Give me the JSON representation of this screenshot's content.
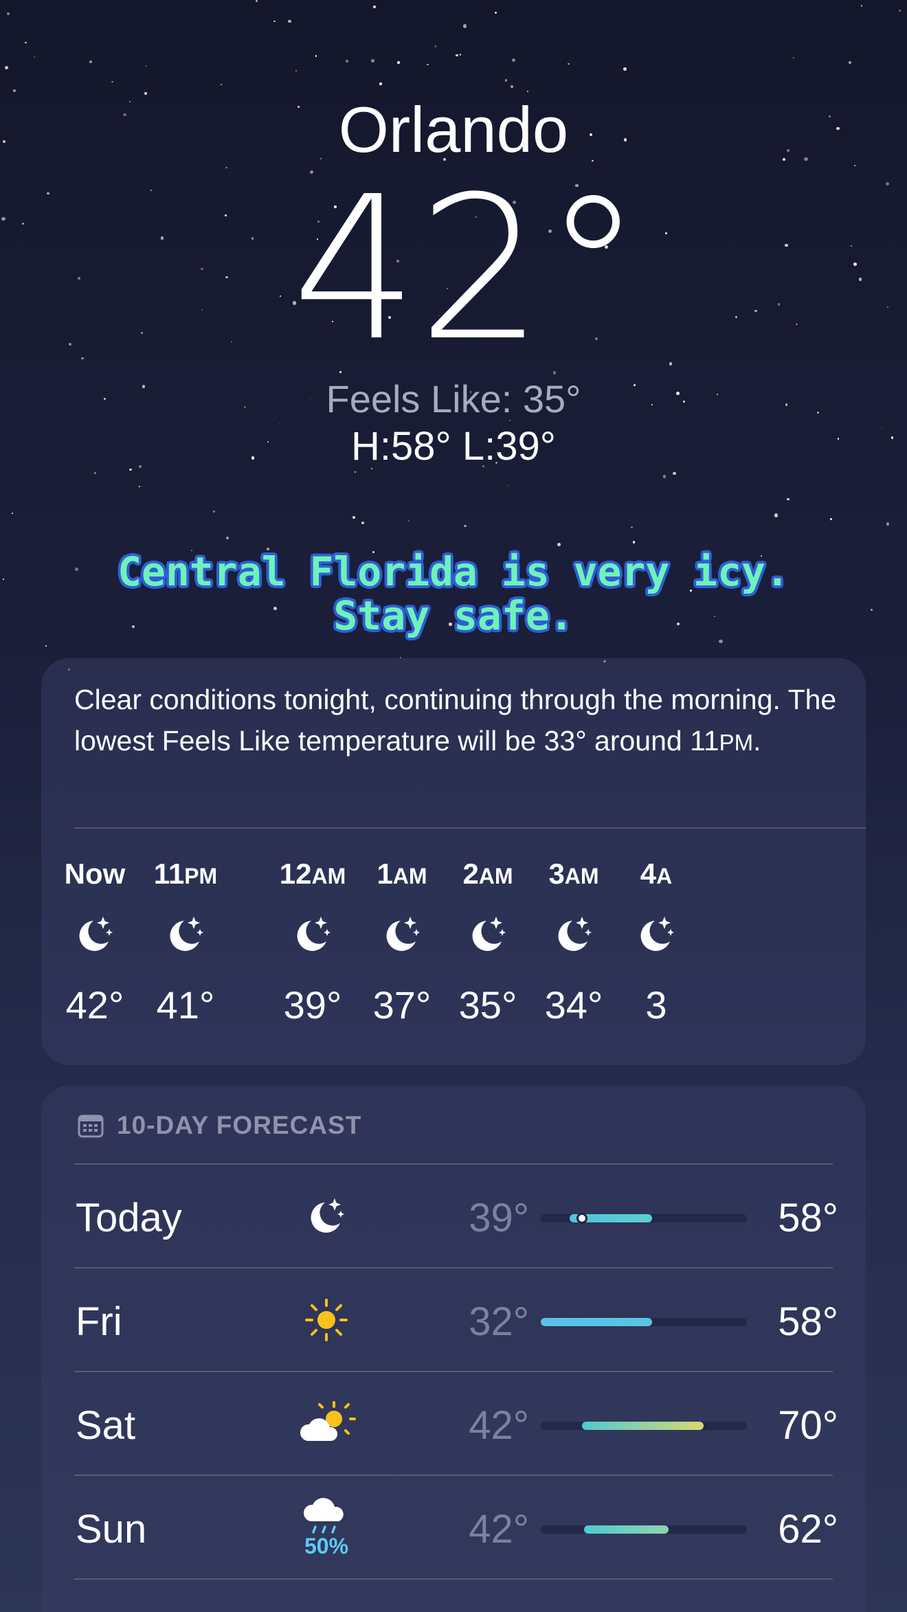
{
  "location": {
    "city": "Orlando",
    "temperature": "42°",
    "feels_like": "Feels Like: 35°",
    "high_low": "H:58°  L:39°"
  },
  "banner": {
    "line1": "Central Florida is very icy.",
    "line2": "Stay safe."
  },
  "hourly": {
    "summary_part1": "Clear conditions tonight, continuing through the morning. The lowest Feels Like temperature will be 33° around 11",
    "summary_suffix": "PM",
    "summary_end": ".",
    "hours": [
      {
        "label": "Now",
        "suffix": "",
        "icon": "moon-stars-icon",
        "temp": "42°"
      },
      {
        "label": "11",
        "suffix": "PM",
        "icon": "moon-stars-icon",
        "temp": "41°"
      },
      {
        "label": "12",
        "suffix": "AM",
        "icon": "moon-stars-icon",
        "temp": "39°"
      },
      {
        "label": "1",
        "suffix": "AM",
        "icon": "moon-stars-icon",
        "temp": "37°"
      },
      {
        "label": "2",
        "suffix": "AM",
        "icon": "moon-stars-icon",
        "temp": "35°"
      },
      {
        "label": "3",
        "suffix": "AM",
        "icon": "moon-stars-icon",
        "temp": "34°"
      },
      {
        "label": "4",
        "suffix": "A",
        "icon": "moon-stars-icon",
        "temp": "3"
      }
    ]
  },
  "forecast": {
    "header": "10-DAY FORECAST",
    "header_icon": "calendar-icon",
    "days": [
      {
        "day": "Today",
        "icon": "moon-stars-icon",
        "pop": "",
        "low": "39°",
        "high": "58°",
        "bar_start": 0.14,
        "bar_end": 0.54,
        "current": 0.2,
        "colors": [
          "#4fc3d9",
          "#5ad0d0"
        ]
      },
      {
        "day": "Fri",
        "icon": "sun-icon",
        "pop": "",
        "low": "32°",
        "high": "58°",
        "bar_start": 0.0,
        "bar_end": 0.54,
        "current": null,
        "colors": [
          "#5bc0eb",
          "#55c8e0"
        ]
      },
      {
        "day": "Sat",
        "icon": "partly-sunny-icon",
        "pop": "",
        "low": "42°",
        "high": "70°",
        "bar_start": 0.2,
        "bar_end": 0.79,
        "current": null,
        "colors": [
          "#4fc9d0",
          "#d8d872"
        ]
      },
      {
        "day": "Sun",
        "icon": "rain-cloud-icon",
        "pop": "50%",
        "low": "42°",
        "high": "62°",
        "bar_start": 0.21,
        "bar_end": 0.62,
        "current": null,
        "colors": [
          "#4fc9d0",
          "#8fd4b0"
        ]
      }
    ]
  },
  "colors": {
    "banner_text": "#6ff2b9",
    "banner_outline": "#2f5fd6",
    "precip": "#5ec9f5",
    "sun": "#f7c21a"
  }
}
